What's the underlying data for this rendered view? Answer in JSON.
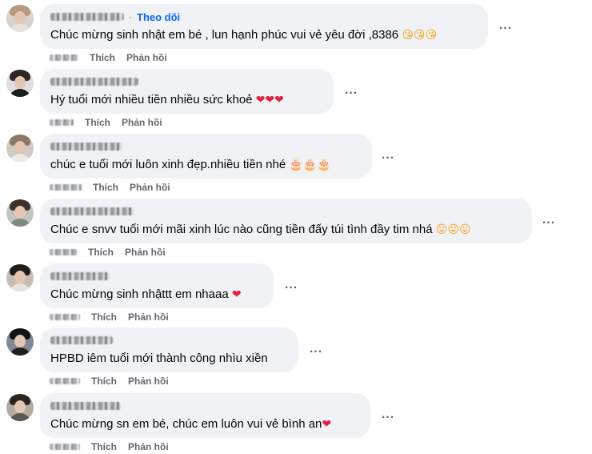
{
  "comments": [
    {
      "text": "Chúc mừng sinh nhật em bé , lun hạnh phúc vui vẻ yêu đời ,8386 ",
      "emoji": "😘😘😘",
      "emoji_type": "face",
      "follow": "Theo dõi",
      "separator": "·"
    },
    {
      "text": "Hý tuổi mới nhiều tiền nhiều sức khoẻ ",
      "emoji": "❤❤❤",
      "emoji_type": "heart"
    },
    {
      "text": "chúc e tuổi mới luôn xinh đẹp.nhiều tiền nhé ",
      "emoji": "🎂🎂🎂",
      "emoji_type": "cake"
    },
    {
      "text": "Chúc e snvv tuổi mới mãi xinh lúc nào cũng tiền đấy túi tình đầy tim nhá ",
      "emoji": "😛😛😛",
      "emoji_type": "face"
    },
    {
      "text": "Chúc mừng sinh nhậttt em nhaaa ",
      "emoji": "❤",
      "emoji_type": "heart"
    },
    {
      "text": "HPBD iêm tuổi mới thành công nhìu xiền",
      "emoji": "",
      "emoji_type": "none"
    },
    {
      "text": "Chúc mừng sn em bé, chúc em luôn vui vẻ bình an",
      "emoji": "❤",
      "emoji_type": "heart"
    }
  ],
  "actions": {
    "like": "Thích",
    "reply": "Phản hồi"
  },
  "more_label": "...",
  "colors": {
    "bubble": "#f0f2f5",
    "action_text": "#65676b",
    "follow": "#0866ff",
    "heart": "#e41e3f"
  }
}
